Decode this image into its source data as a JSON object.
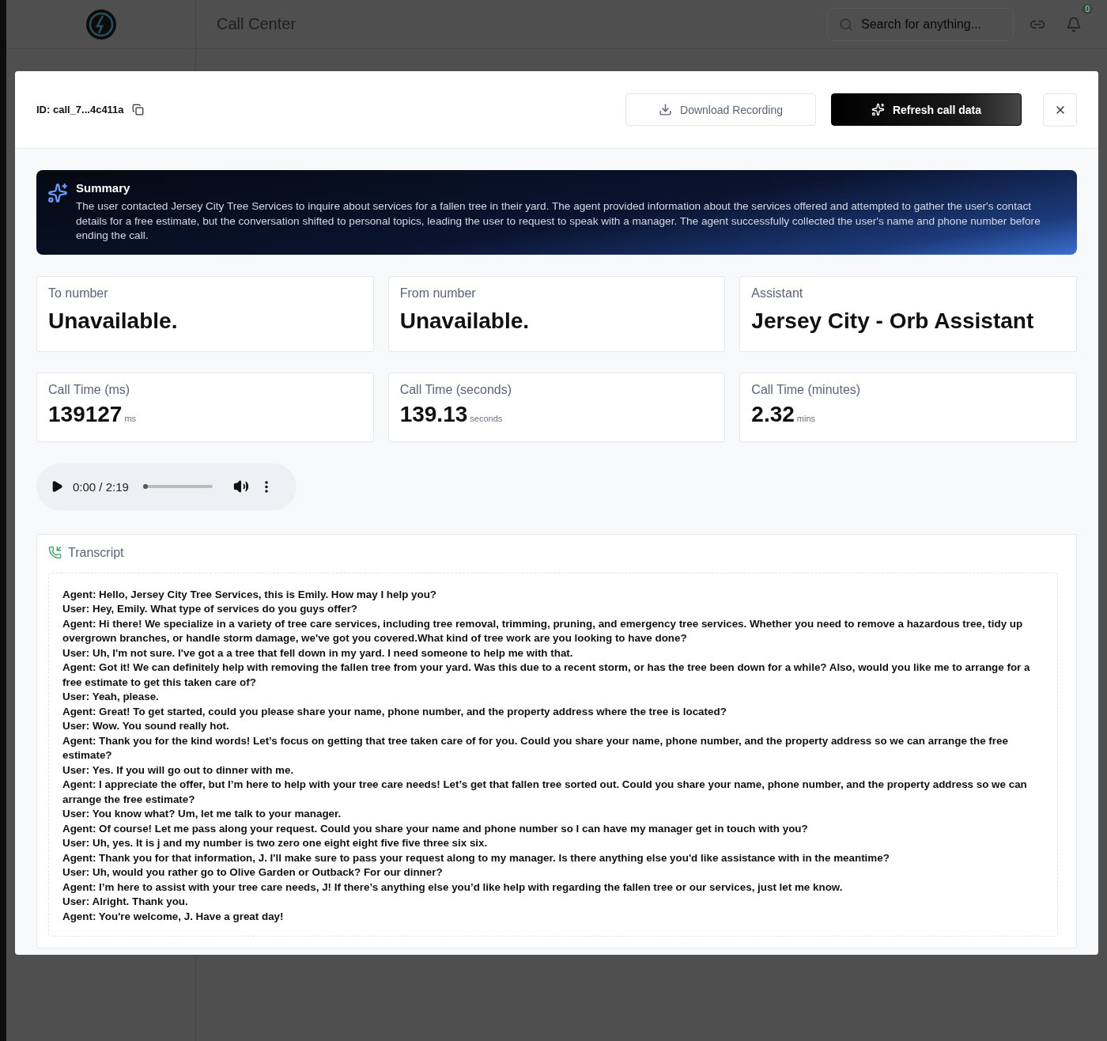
{
  "app": {
    "title": "Call Center",
    "search": {
      "placeholder": "Search for anything..."
    },
    "notifications": {
      "count": "0"
    }
  },
  "modal": {
    "call_id": "ID: call_7...4c411a",
    "actions": [
      {
        "kind": "outline",
        "label": "Download Recording"
      },
      {
        "kind": "primary",
        "label": "Refresh call data"
      }
    ],
    "summary": {
      "title": "Summary",
      "text": "The user contacted Jersey City Tree Services to inquire about services for a fallen tree in their yard. The agent provided information about the services offered and attempted to gather the user's contact details for a free estimate, but the conversation shifted to personal topics, leading the user to request to speak with a manager. The agent successfully collected the user's name and phone number before ending the call."
    },
    "details": [
      {
        "kind": "text",
        "label": "To number",
        "value": "Unavailable."
      },
      {
        "kind": "text",
        "label": "From number",
        "value": "Unavailable."
      },
      {
        "kind": "text",
        "label": "Assistant",
        "value": "Jersey City - Orb Assistant"
      },
      {
        "kind": "measure",
        "label": "Call Time (ms)",
        "value": "139127",
        "unit": "ms"
      },
      {
        "kind": "measure",
        "label": "Call Time (seconds)",
        "value": "139.13",
        "unit": "seconds"
      },
      {
        "kind": "measure",
        "label": "Call Time (minutes)",
        "value": "2.32",
        "unit": "mins"
      }
    ],
    "player": {
      "time": "0:00 / 2:19",
      "level": 0
    },
    "transcript": {
      "title": "Transcript",
      "lines": [
        "Agent: Hello, Jersey City Tree Services, this is Emily. How may I help you?",
        "User: Hey, Emily. What type of services do you guys offer?",
        "Agent: Hi there! We specialize in a variety of tree care services, including tree removal, trimming, pruning, and emergency tree services. Whether you need to remove a hazardous tree, tidy up overgrown branches, or handle storm damage, we've got you covered.What kind of tree work are you looking to have done?",
        "User: Uh, I'm not sure. I've got a a tree that fell down in my yard. I need someone to help me with that.",
        "Agent: Got it! We can definitely help with removing the fallen tree from your yard. Was this due to a recent storm, or has the tree been down for a while? Also, would you like me to arrange for a free estimate to get this taken care of?",
        "User: Yeah, please.",
        "Agent: Great! To get started, could you please share your name, phone number, and the property address where the tree is located?",
        "User: Wow. You sound really hot.",
        "Agent: Thank you for the kind words! Let’s focus on getting that tree taken care of for you. Could you share your name, phone number, and the property address so we can arrange the free estimate?",
        "User: Yes. If you will go out to dinner with me.",
        "Agent: I appreciate the offer, but I’m here to help with your tree care needs! Let’s get that fallen tree sorted out. Could you share your name, phone number, and the property address so we can arrange the free estimate?",
        "User: You know what? Um, let me talk to your manager.",
        "Agent: Of course! Let me pass along your request. Could you share your name and phone number so I can have my manager get in touch with you?",
        "User: Uh, yes. It is j and my number is two zero one eight eight five five three six six.",
        "Agent: Thank you for that information, J. I'll make sure to pass your request along to my manager. Is there anything else you'd like assistance with in the meantime?",
        "User: Uh, would you rather go to Olive Garden or Outback? For our dinner?",
        "Agent: I’m here to assist with your tree care needs, J! If there’s anything else you’d like help with regarding the fallen tree or our services, just let me know.",
        "User: Alright. Thank you.",
        "Agent: You're welcome, J. Have a great day!"
      ]
    }
  }
}
